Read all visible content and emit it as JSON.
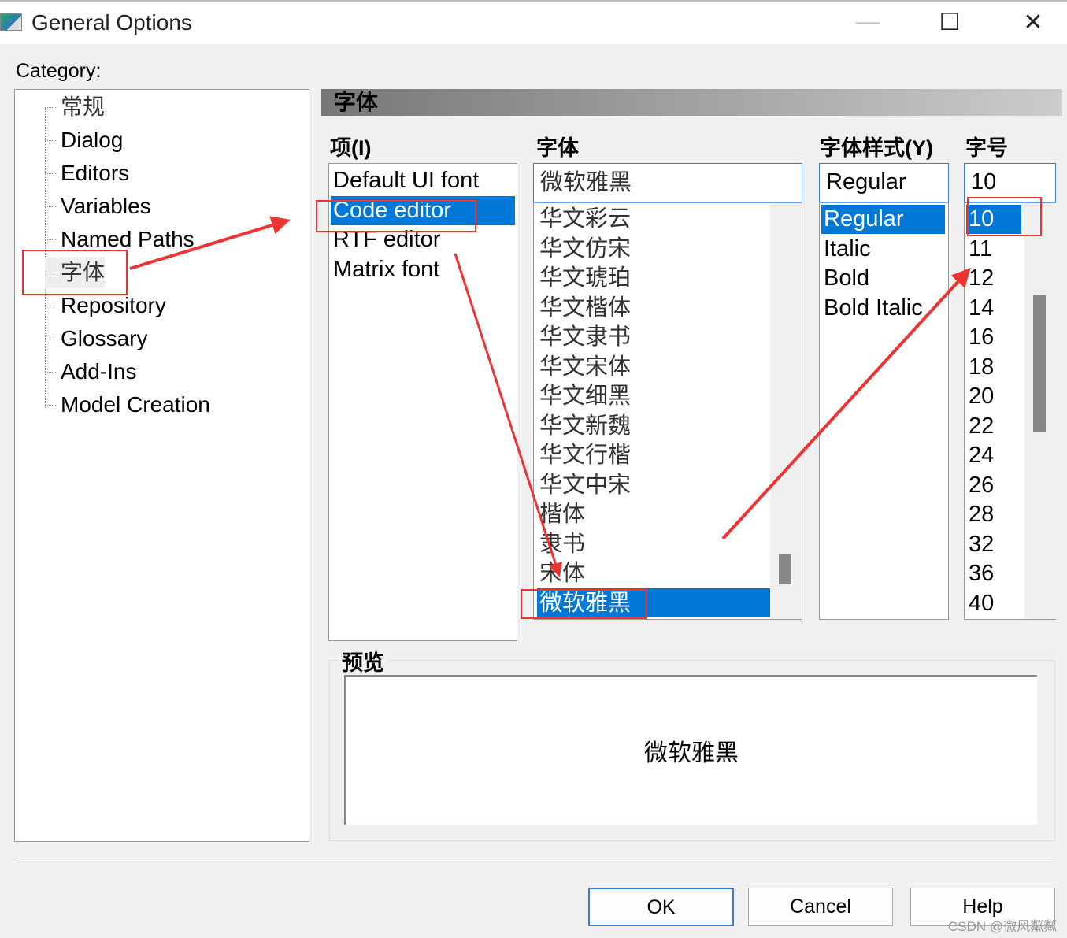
{
  "window": {
    "title": "General Options",
    "minimize": "—",
    "maximize": "☐",
    "close": "✕"
  },
  "category": {
    "label": "Category:",
    "items": [
      "常规",
      "Dialog",
      "Editors",
      "Variables",
      "Named Paths",
      "字体",
      "Repository",
      "Glossary",
      "Add-Ins",
      "Model Creation"
    ],
    "selected": "字体"
  },
  "panel": {
    "header": "字体",
    "items_label": "项(I)",
    "items": [
      "Default UI font",
      "Code editor",
      "RTF editor",
      "Matrix font"
    ],
    "items_selected": "Code editor",
    "font_label": "字体",
    "font_value": "微软雅黑",
    "fonts": [
      "华文彩云",
      "华文仿宋",
      "华文琥珀",
      "华文楷体",
      "华文隶书",
      "华文宋体",
      "华文细黑",
      "华文新魏",
      "华文行楷",
      "华文中宋",
      "楷体",
      "隶书",
      "宋体",
      "微软雅黑"
    ],
    "font_selected": "微软雅黑",
    "style_label": "字体样式(Y)",
    "style_value": "Regular",
    "styles": [
      "Regular",
      "Italic",
      "Bold",
      "Bold Italic"
    ],
    "style_selected": "Regular",
    "size_label": "字号",
    "size_value": "10",
    "sizes": [
      "10",
      "11",
      "12",
      "14",
      "16",
      "18",
      "20",
      "22",
      "24",
      "26",
      "28",
      "32",
      "36",
      "40"
    ],
    "size_selected": "10",
    "preview_label": "预览",
    "preview_text": "微软雅黑"
  },
  "buttons": {
    "ok": "OK",
    "cancel": "Cancel",
    "help": "Help"
  },
  "watermark": "CSDN @微风粼粼",
  "colors": {
    "selection": "#0078d7",
    "annotation": "#e33333"
  }
}
